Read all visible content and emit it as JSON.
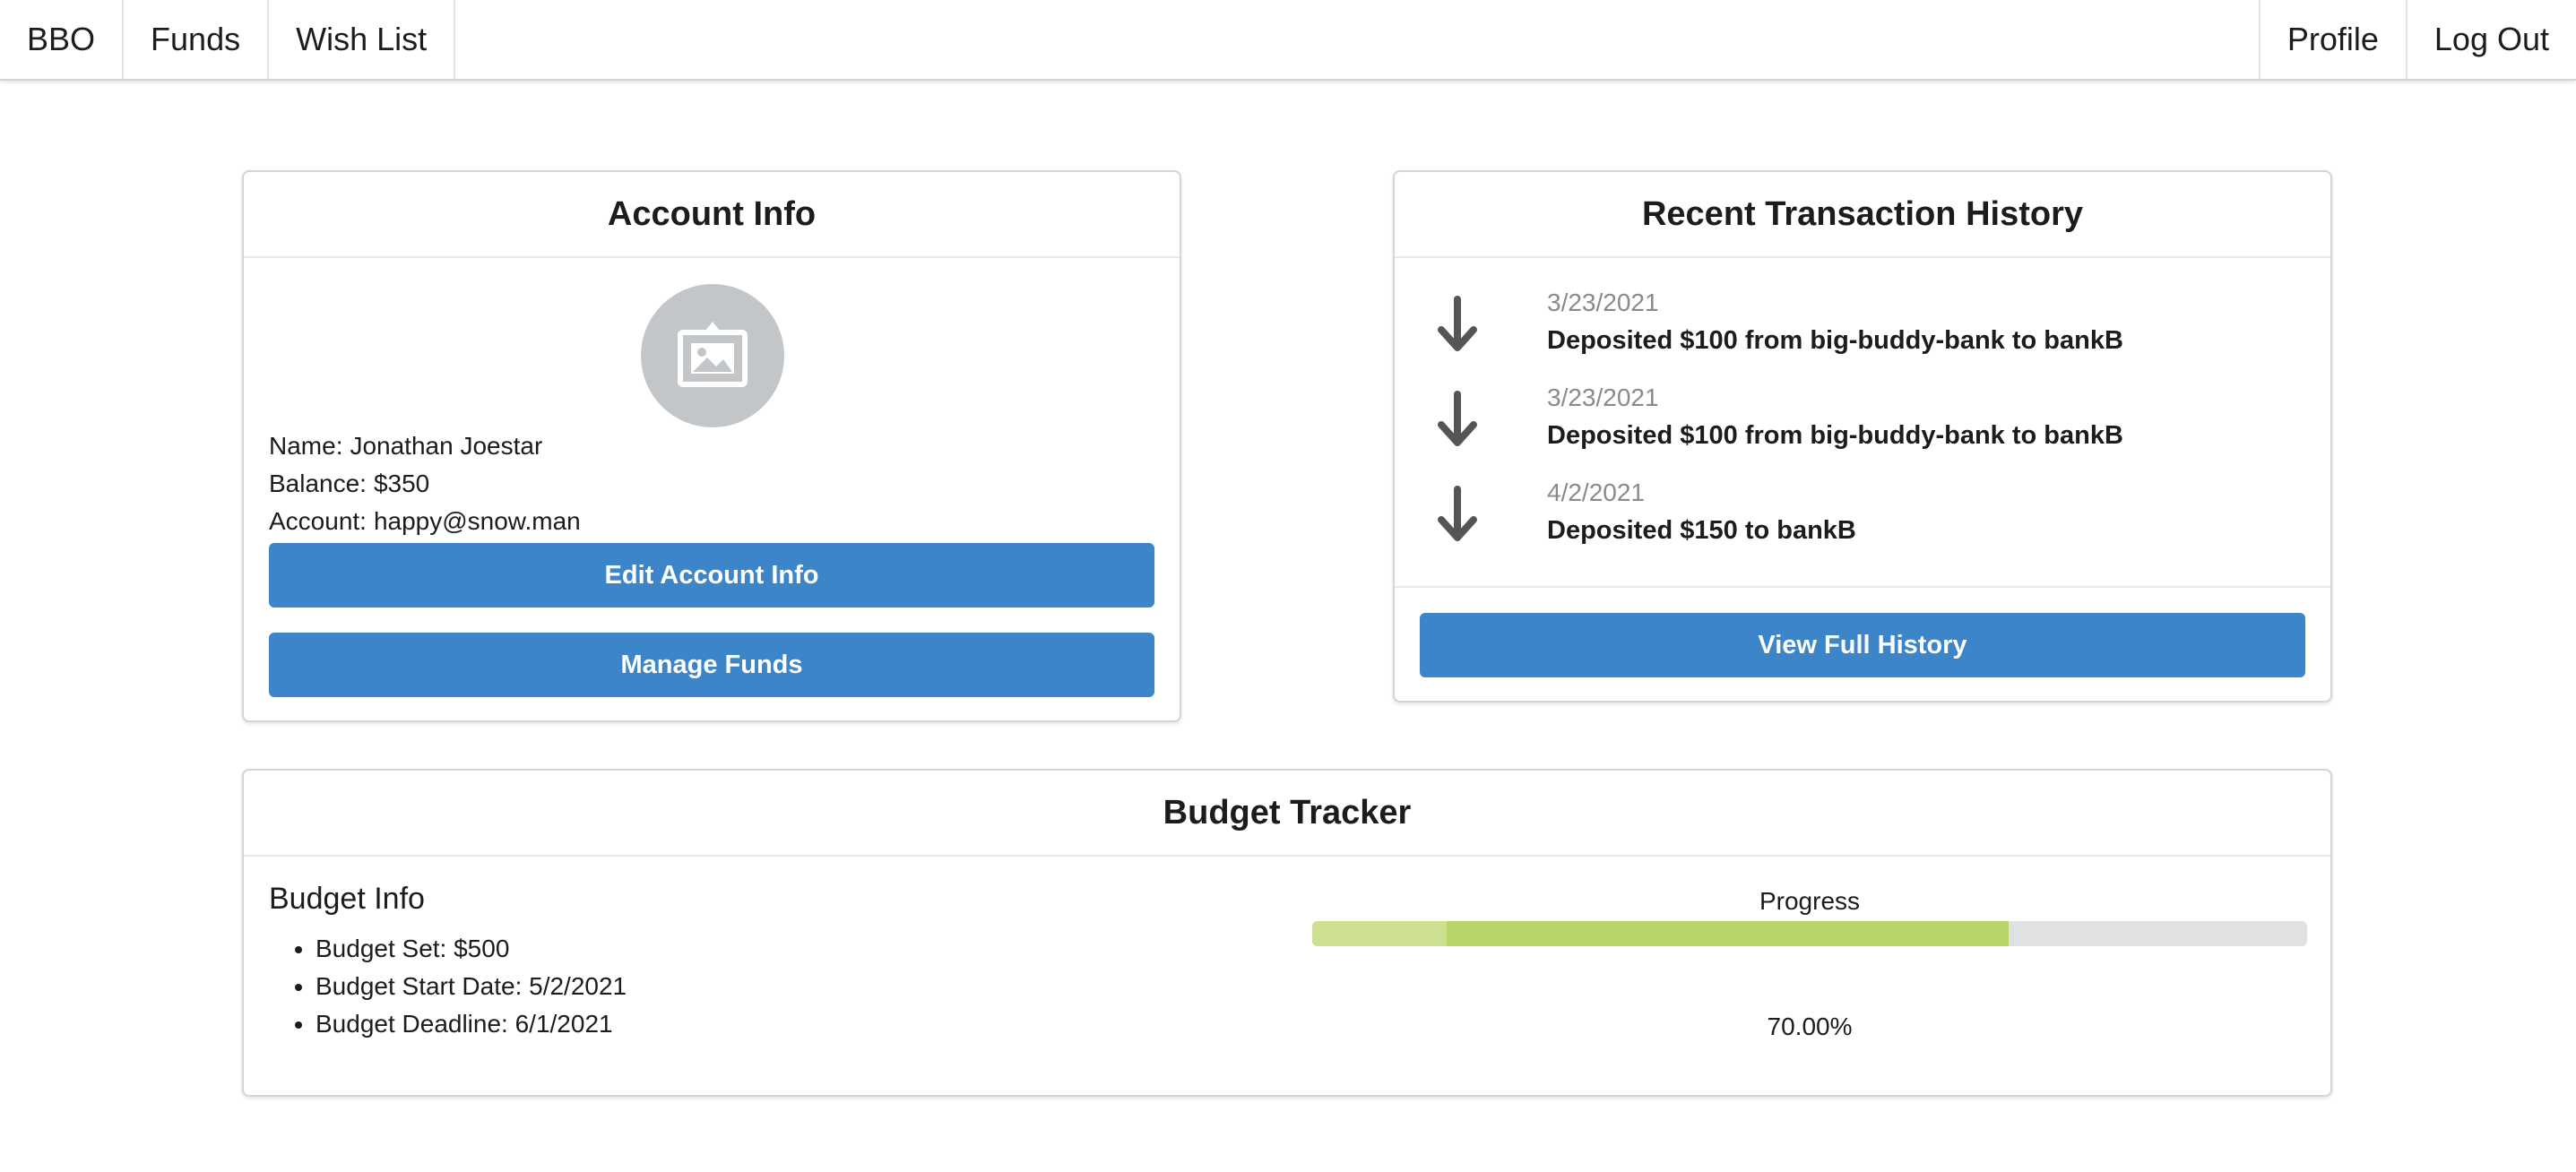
{
  "nav": {
    "left": [
      "BBO",
      "Funds",
      "Wish List"
    ],
    "right": [
      "Profile",
      "Log Out"
    ]
  },
  "account": {
    "title": "Account Info",
    "avatar_icon": "image-placeholder-icon",
    "name_label": "Name:",
    "name": "Jonathan Joestar",
    "balance_label": "Balance:",
    "balance": "$350",
    "account_label": "Account:",
    "account": "happy@snow.man",
    "edit_label": "Edit Account Info",
    "manage_label": "Manage Funds"
  },
  "history": {
    "title": "Recent Transaction History",
    "items": [
      {
        "date": "3/23/2021",
        "description": "Deposited $100 from big-buddy-bank to bankB",
        "icon": "arrow-down-icon"
      },
      {
        "date": "3/23/2021",
        "description": "Deposited $100 from big-buddy-bank to bankB",
        "icon": "arrow-down-icon"
      },
      {
        "date": "4/2/2021",
        "description": "Deposited $150 to bankB",
        "icon": "arrow-down-icon"
      }
    ],
    "view_full_label": "View Full History"
  },
  "budget": {
    "title": "Budget Tracker",
    "info_title": "Budget Info",
    "items": [
      "Budget Set: $500",
      "Budget Start Date: 5/2/2021",
      "Budget Deadline: 6/1/2021"
    ],
    "progress_label": "Progress",
    "progress_value": 0.7,
    "progress_secondary": 0.135,
    "progress_text": "70.00%"
  },
  "colors": {
    "primary_button": "#3d85c9",
    "progress_fill": "#b7d468",
    "progress_secondary": "#cde08f",
    "progress_track": "#e0e1e2",
    "avatar_bg": "#c3c6c8",
    "date_text": "#8a8a8a"
  }
}
